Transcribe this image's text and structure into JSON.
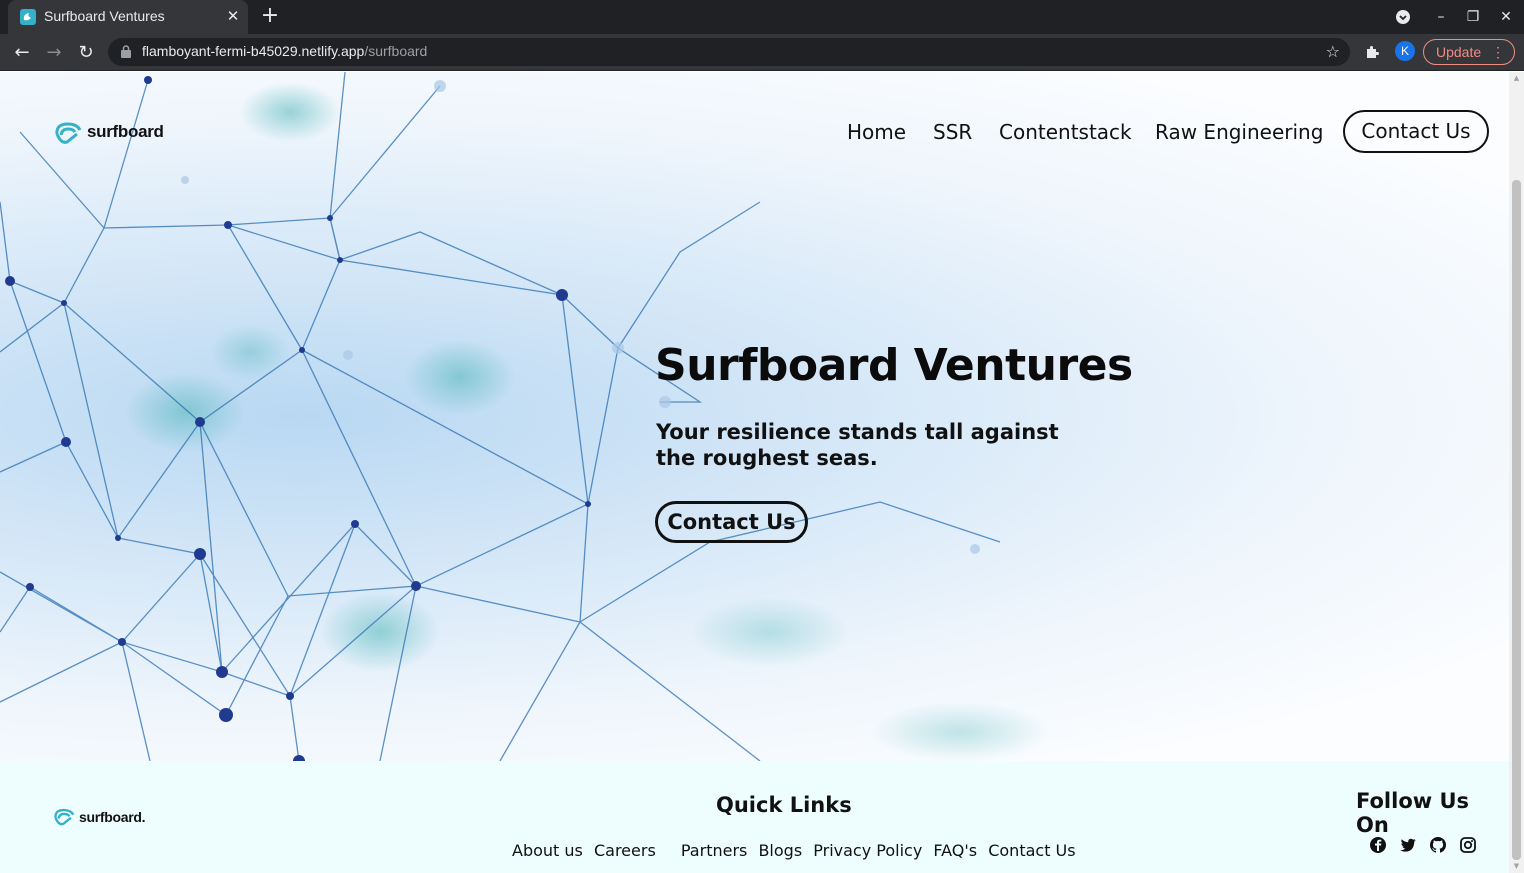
{
  "browser": {
    "tab_title": "Surfboard Ventures",
    "url_host": "flamboyant-fermi-b45029.netlify.app",
    "url_path": "/surfboard",
    "profile_initial": "K",
    "update_label": "Update"
  },
  "site": {
    "logo_text": "surfboard",
    "nav": [
      "Home",
      "SSR",
      "Contentstack",
      "Raw Engineering"
    ],
    "nav_cta": "Contact Us"
  },
  "hero": {
    "title": "Surfboard Ventures",
    "subtitle": "Your resilience stands tall against the roughest seas.",
    "cta": "Contact Us"
  },
  "footer": {
    "logo_text": "surfboard.",
    "quick_links_heading": "Quick Links",
    "links": [
      "About us",
      "Careers",
      "Partners",
      "Blogs",
      "Privacy Policy",
      "FAQ's",
      "Contact Us"
    ],
    "follow_heading": "Follow Us On",
    "social_icons": [
      "facebook-icon",
      "twitter-icon",
      "github-icon",
      "instagram-icon"
    ]
  },
  "colors": {
    "brand_teal": "#34b1c8",
    "chrome_dark": "#202124",
    "chrome_toolbar": "#35363a",
    "footer_bg": "#eefefe",
    "update_red": "#f28b82"
  }
}
